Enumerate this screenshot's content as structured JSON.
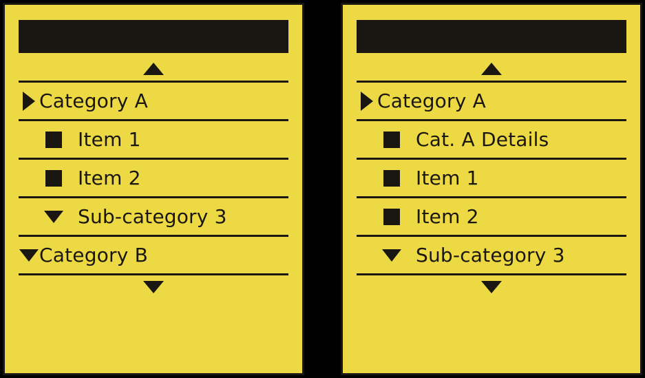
{
  "left_panel": {
    "rows": [
      {
        "type": "category",
        "expanded": true,
        "label": "Category A"
      },
      {
        "type": "item",
        "label": "Item 1"
      },
      {
        "type": "item",
        "label": "Item 2"
      },
      {
        "type": "subcategory",
        "expanded": false,
        "label": "Sub-category 3"
      },
      {
        "type": "category",
        "expanded": false,
        "label": "Category B"
      }
    ]
  },
  "right_panel": {
    "rows": [
      {
        "type": "category",
        "expanded": true,
        "label": "Category A"
      },
      {
        "type": "item",
        "label": "Cat. A Details"
      },
      {
        "type": "item",
        "label": "Item 1"
      },
      {
        "type": "item",
        "label": "Item 2"
      },
      {
        "type": "subcategory",
        "expanded": false,
        "label": "Sub-category 3"
      }
    ]
  }
}
